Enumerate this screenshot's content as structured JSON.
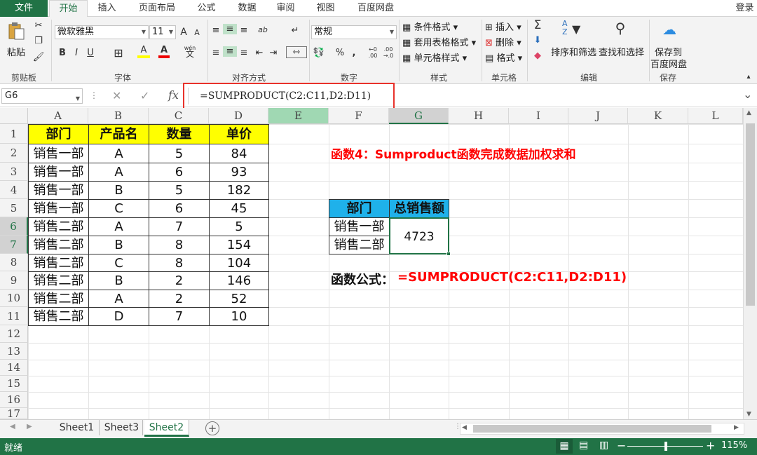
{
  "tabs": {
    "file": "文件",
    "home": "开始",
    "insert": "插入",
    "layout": "页面布局",
    "formula": "公式",
    "data": "数据",
    "review": "审阅",
    "view": "视图",
    "baidu": "百度网盘",
    "login": "登录"
  },
  "ribbon": {
    "clipboard": {
      "label": "剪贴板",
      "paste": "粘贴"
    },
    "font": {
      "label": "字体",
      "name": "微软雅黑",
      "size": "11",
      "grow": "A",
      "shrink": "A",
      "bold": "B",
      "italic": "I",
      "underline": "U",
      "fill": "A",
      "color": "A",
      "wen_top": "wén",
      "wen": "文"
    },
    "align": {
      "label": "对齐方式",
      "orient": "ab"
    },
    "number": {
      "label": "数字",
      "format": "常规",
      "percent": "%",
      "comma": ",",
      "inc_top": "←0",
      "inc_bot": ".00",
      "dec_top": ".00",
      "dec_bot": "→.0"
    },
    "styles": {
      "label": "样式",
      "cond": "条件格式",
      "table": "套用表格格式",
      "cell": "单元格样式"
    },
    "cells": {
      "label": "单元格",
      "insert": "插入",
      "delete": "删除",
      "format": "格式"
    },
    "edit": {
      "label": "编辑",
      "sum": "Σ",
      "sort": "排序和筛选",
      "find": "查找和选择",
      "az_top": "A",
      "az_bot": "Z"
    },
    "save": {
      "label": "保存",
      "line1": "保存到",
      "line2": "百度网盘"
    }
  },
  "formula_bar": {
    "name_box": "G6",
    "fx": "fx",
    "cancel": "✕",
    "confirm": "✓",
    "formula": "=SUMPRODUCT(C2:C11,D2:D11)",
    "expand": "⌄"
  },
  "columns": [
    "A",
    "B",
    "C",
    "D",
    "E",
    "F",
    "G",
    "H",
    "I",
    "J",
    "K",
    "L"
  ],
  "rows": [
    "1",
    "2",
    "3",
    "4",
    "5",
    "6",
    "7",
    "8",
    "9",
    "10",
    "11",
    "12",
    "13",
    "14",
    "15",
    "16",
    "17"
  ],
  "table": {
    "headers": [
      "部门",
      "产品名",
      "数量",
      "单价"
    ],
    "rows": [
      [
        "销售一部",
        "A",
        "5",
        "84"
      ],
      [
        "销售一部",
        "A",
        "6",
        "93"
      ],
      [
        "销售一部",
        "B",
        "5",
        "182"
      ],
      [
        "销售一部",
        "C",
        "6",
        "45"
      ],
      [
        "销售二部",
        "A",
        "7",
        "5"
      ],
      [
        "销售二部",
        "B",
        "8",
        "154"
      ],
      [
        "销售二部",
        "C",
        "8",
        "104"
      ],
      [
        "销售二部",
        "B",
        "2",
        "146"
      ],
      [
        "销售二部",
        "A",
        "2",
        "52"
      ],
      [
        "销售二部",
        "D",
        "7",
        "10"
      ]
    ]
  },
  "title_text": "函数4：Sumproduct函数完成数据加权求和",
  "summary": {
    "headers": [
      "部门",
      "总销售额"
    ],
    "depts": [
      "销售一部",
      "销售二部"
    ],
    "value": "4723"
  },
  "formula_label": "函数公式：",
  "formula_text": "=SUMPRODUCT(C2:C11,D2:D11)",
  "sheets": [
    "Sheet1",
    "Sheet3",
    "Sheet2"
  ],
  "active_sheet": "Sheet2",
  "status": {
    "ready": "就绪",
    "zoom": "115%",
    "minus": "−",
    "plus": "+"
  },
  "colors": {
    "excel_green": "#217346",
    "header_yellow": "#ffff00",
    "header_blue": "#1fb1ea",
    "red_text": "#ff0000",
    "highlight_box": "#e8322b"
  }
}
